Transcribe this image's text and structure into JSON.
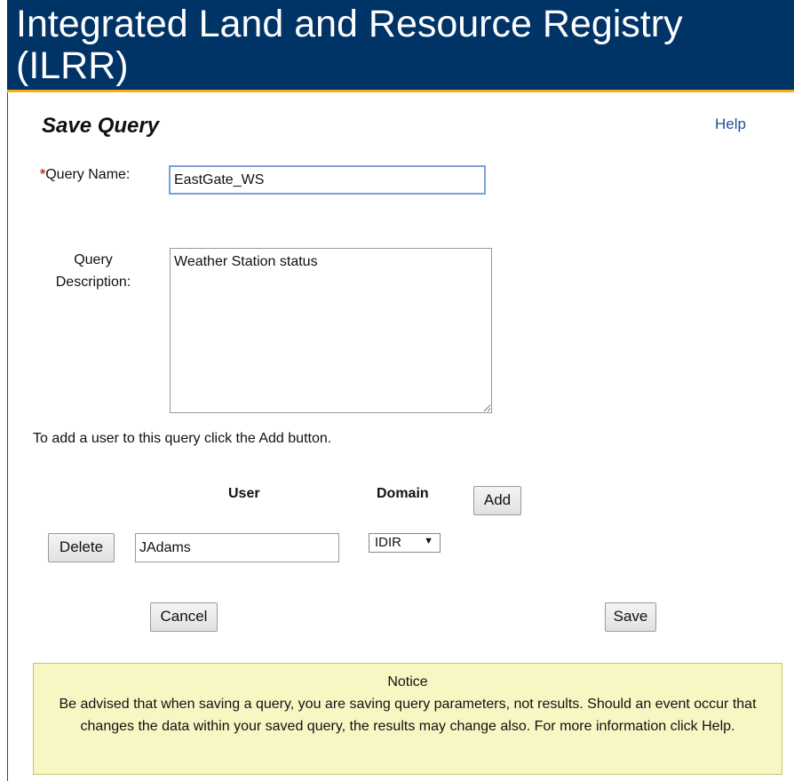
{
  "header": {
    "title": "Integrated Land and Resource Registry (ILRR)"
  },
  "page": {
    "title": "Save Query",
    "help_label": "Help"
  },
  "form": {
    "required_mark": "*",
    "query_name_label": "Query Name:",
    "query_name_value": "EastGate_WS",
    "query_desc_label_line1": "Query",
    "query_desc_label_line2": "Description:",
    "query_desc_value": "Weather Station status"
  },
  "users": {
    "hint": "To add a user to this query click the Add button.",
    "user_header": "User",
    "domain_header": "Domain",
    "add_label": "Add",
    "rows": [
      {
        "delete_label": "Delete",
        "user": "JAdams",
        "domain": "IDIR"
      }
    ]
  },
  "actions": {
    "cancel_label": "Cancel",
    "save_label": "Save"
  },
  "notice": {
    "title": "Notice",
    "body": "Be advised that when saving a query, you are saving query parameters, not results. Should an event occur that changes the data within your saved query, the results may change also. For more information click Help."
  },
  "colors": {
    "banner": "#003366",
    "banner_accent": "#f2b01e",
    "notice_bg": "#f8f7c4",
    "link": "#1f4f8f"
  }
}
